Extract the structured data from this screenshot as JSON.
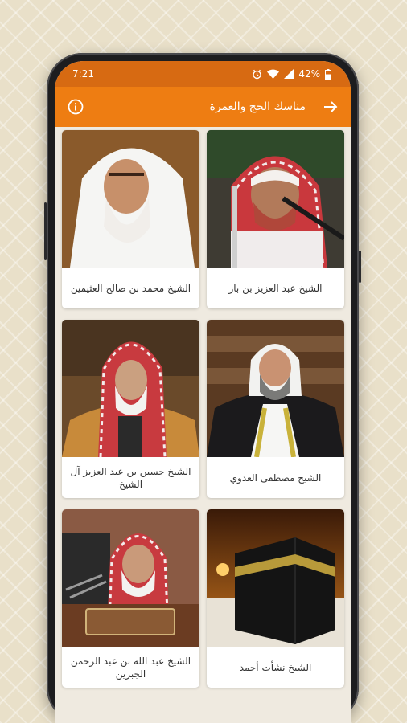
{
  "status": {
    "time": "7:21",
    "battery": "42%"
  },
  "appbar": {
    "title": "مناسك الحج والعمرة"
  },
  "cards": [
    {
      "label": "الشيخ عبد العزيز بن باز"
    },
    {
      "label": "الشيخ محمد بن صالح العثيمين"
    },
    {
      "label": "الشيخ مصطفى العدوي"
    },
    {
      "label": "الشيخ حسين بن عبد العزيز آل الشيخ"
    },
    {
      "label": "الشيخ نشأت أحمد"
    },
    {
      "label": "الشيخ عبد الله بن عبد الرحمن الجبرين"
    }
  ],
  "colors": {
    "statusbar": "#d76a12",
    "appbar": "#ee7d12",
    "background": "#e9e0c9"
  },
  "icons": {
    "back": "arrow-forward-icon",
    "info": "info-icon",
    "alarm": "alarm-icon",
    "wifi": "wifi-icon",
    "signal": "signal-icon",
    "battery": "battery-icon"
  }
}
